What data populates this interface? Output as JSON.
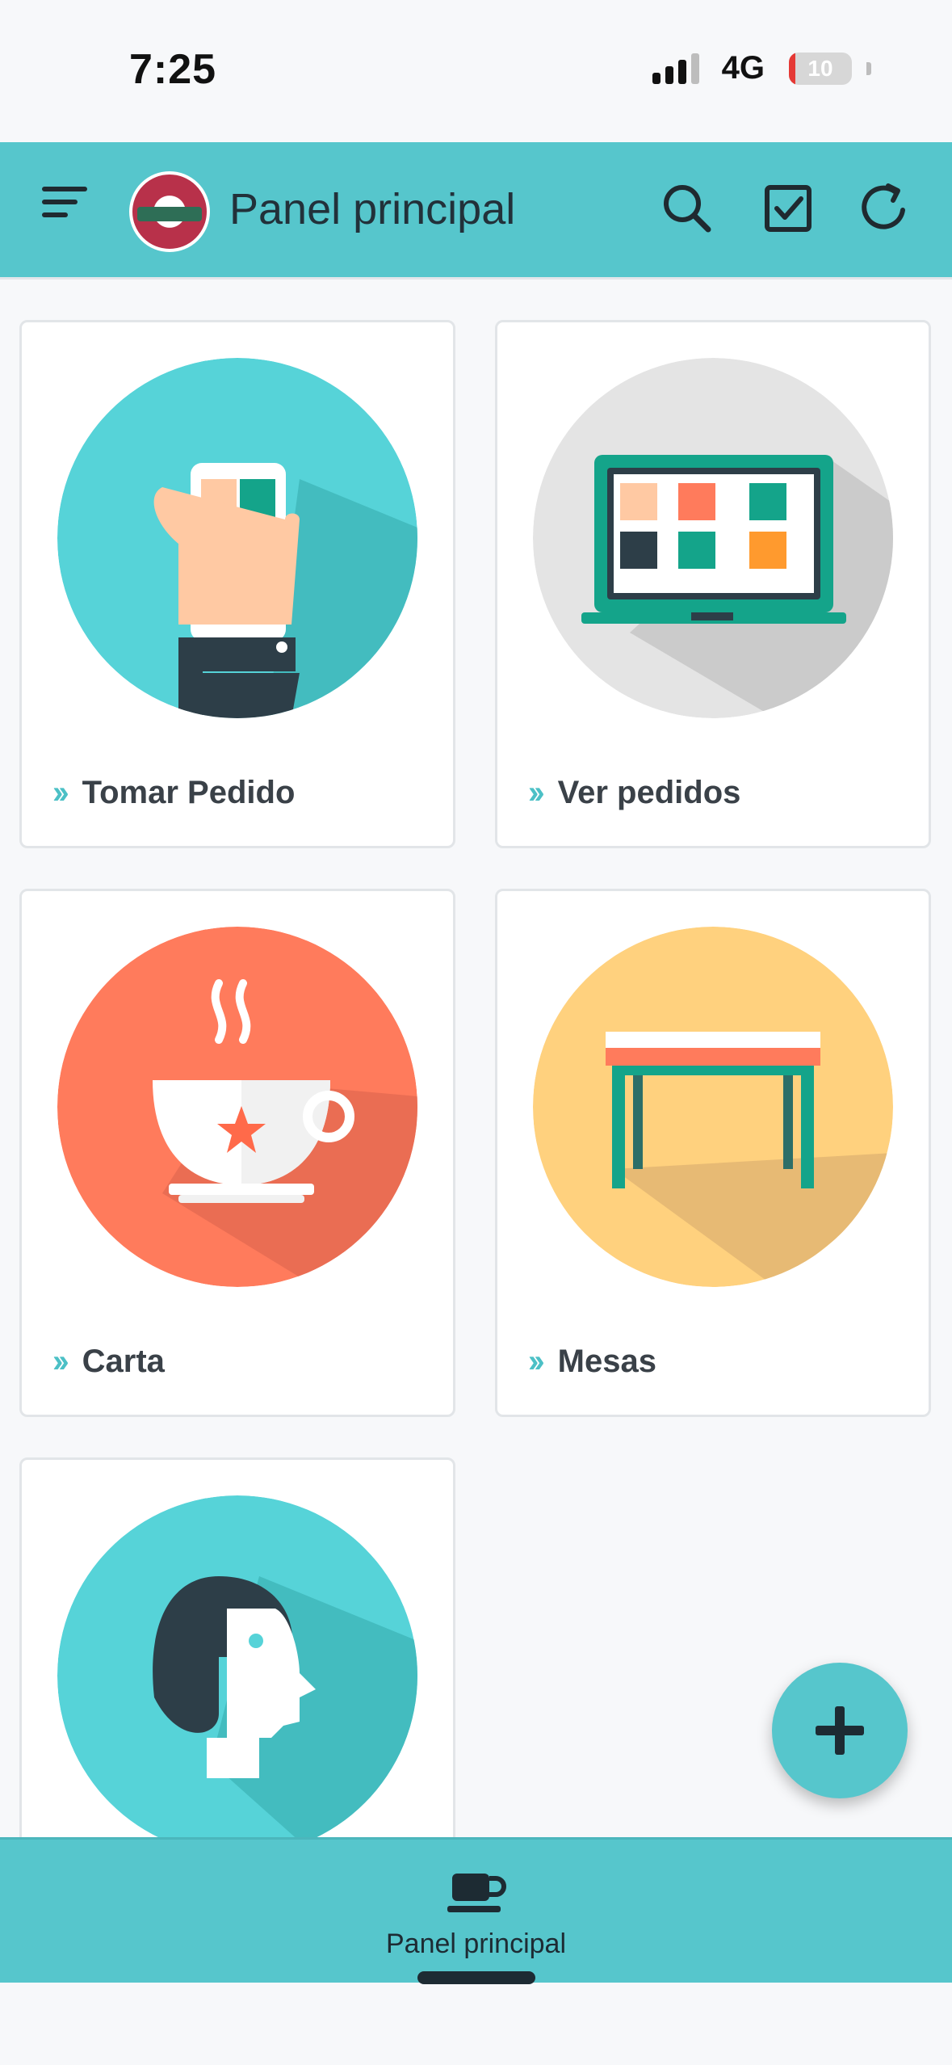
{
  "status_bar": {
    "time": "7:25",
    "network": "4G",
    "battery": "10"
  },
  "app_bar": {
    "title": "Panel principal",
    "icons": [
      "menu-icon",
      "logo",
      "search-icon",
      "checkbox-icon",
      "refresh-icon"
    ]
  },
  "cards": [
    {
      "label": "Tomar Pedido",
      "icon": "phone-in-hand-icon"
    },
    {
      "label": "Ver pedidos",
      "icon": "laptop-icon"
    },
    {
      "label": "Carta",
      "icon": "coffee-cup-icon"
    },
    {
      "label": "Mesas",
      "icon": "table-icon"
    },
    {
      "label": "",
      "icon": "person-profile-icon"
    }
  ],
  "fab": {
    "icon": "plus-icon"
  },
  "bottom_nav": {
    "items": [
      {
        "label": "Panel principal",
        "icon": "coffee-cup-icon"
      }
    ]
  },
  "colors": {
    "accent": "#56c6cc",
    "dark": "#2d3e48",
    "orange": "#ff7b5c",
    "yellow": "#ffd17e",
    "gray": "#e4e4e4"
  }
}
